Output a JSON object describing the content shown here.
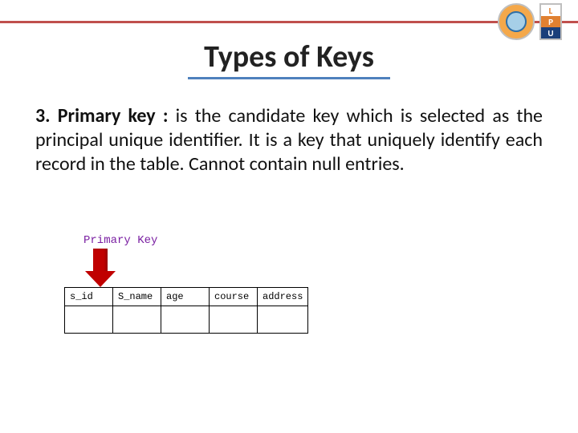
{
  "logos": {
    "lpu_letters": [
      "L",
      "P",
      "U"
    ]
  },
  "title": "Types of Keys",
  "body": {
    "heading": "3. Primary key :",
    "rest": " is the candidate key which is selected as the principal unique identifier. It is a key that uniquely identify each record in the table. Cannot contain null entries."
  },
  "figure": {
    "caption": "Primary Key",
    "columns": [
      "s_id",
      "S_name",
      "age",
      "course",
      "address"
    ]
  }
}
